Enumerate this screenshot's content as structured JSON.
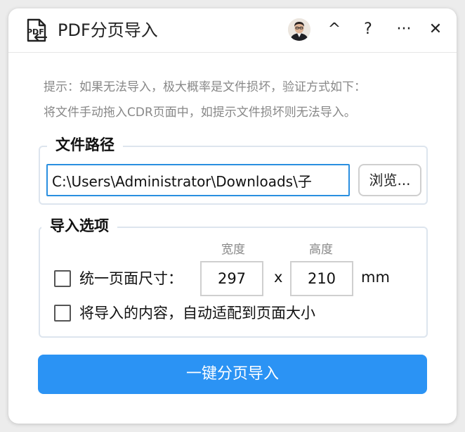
{
  "window": {
    "title": "PDF分页导入",
    "controls": {
      "collapse": "^",
      "help": "?",
      "more": "···",
      "close": "✕"
    }
  },
  "hint": {
    "line1": "提示：如果无法导入，极大概率是文件损坏，验证方式如下：",
    "line2": "将文件手动拖入CDR页面中，如提示文件损坏则无法导入。"
  },
  "file_path": {
    "legend": "文件路径",
    "value": "C:\\Users\\Administrator\\Downloads\\子",
    "browse_label": "浏览..."
  },
  "import_options": {
    "legend": "导入选项",
    "width_label": "宽度",
    "height_label": "高度",
    "unify_size_label": "统一页面尺寸：",
    "unify_size_checked": false,
    "width_value": "297",
    "times": "x",
    "height_value": "210",
    "unit": "mm",
    "auto_fit_label": "将导入的内容，自动适配到页面大小",
    "auto_fit_checked": false
  },
  "primary_action": {
    "label": "一键分页导入"
  },
  "colors": {
    "accent": "#2b93f4",
    "input_focus": "#2a8fe0"
  }
}
